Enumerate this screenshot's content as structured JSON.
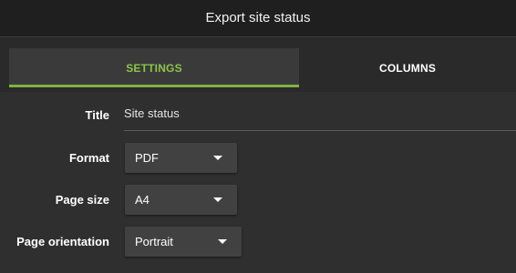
{
  "dialog": {
    "title": "Export site status"
  },
  "tabs": [
    {
      "label": "SETTINGS",
      "active": true
    },
    {
      "label": "COLUMNS",
      "active": false
    }
  ],
  "form": {
    "title_label": "Title",
    "title_value": "Site status",
    "format_label": "Format",
    "format_value": "PDF",
    "page_size_label": "Page size",
    "page_size_value": "A4",
    "orientation_label": "Page orientation",
    "orientation_value": "Portrait"
  },
  "icons": {
    "dropdown": "chevron-down-icon"
  },
  "colors": {
    "accent": "#7cb342",
    "active_tab_text": "#8bc34a",
    "background": "#2f2f2f",
    "titlebar": "#1f1f1f"
  }
}
